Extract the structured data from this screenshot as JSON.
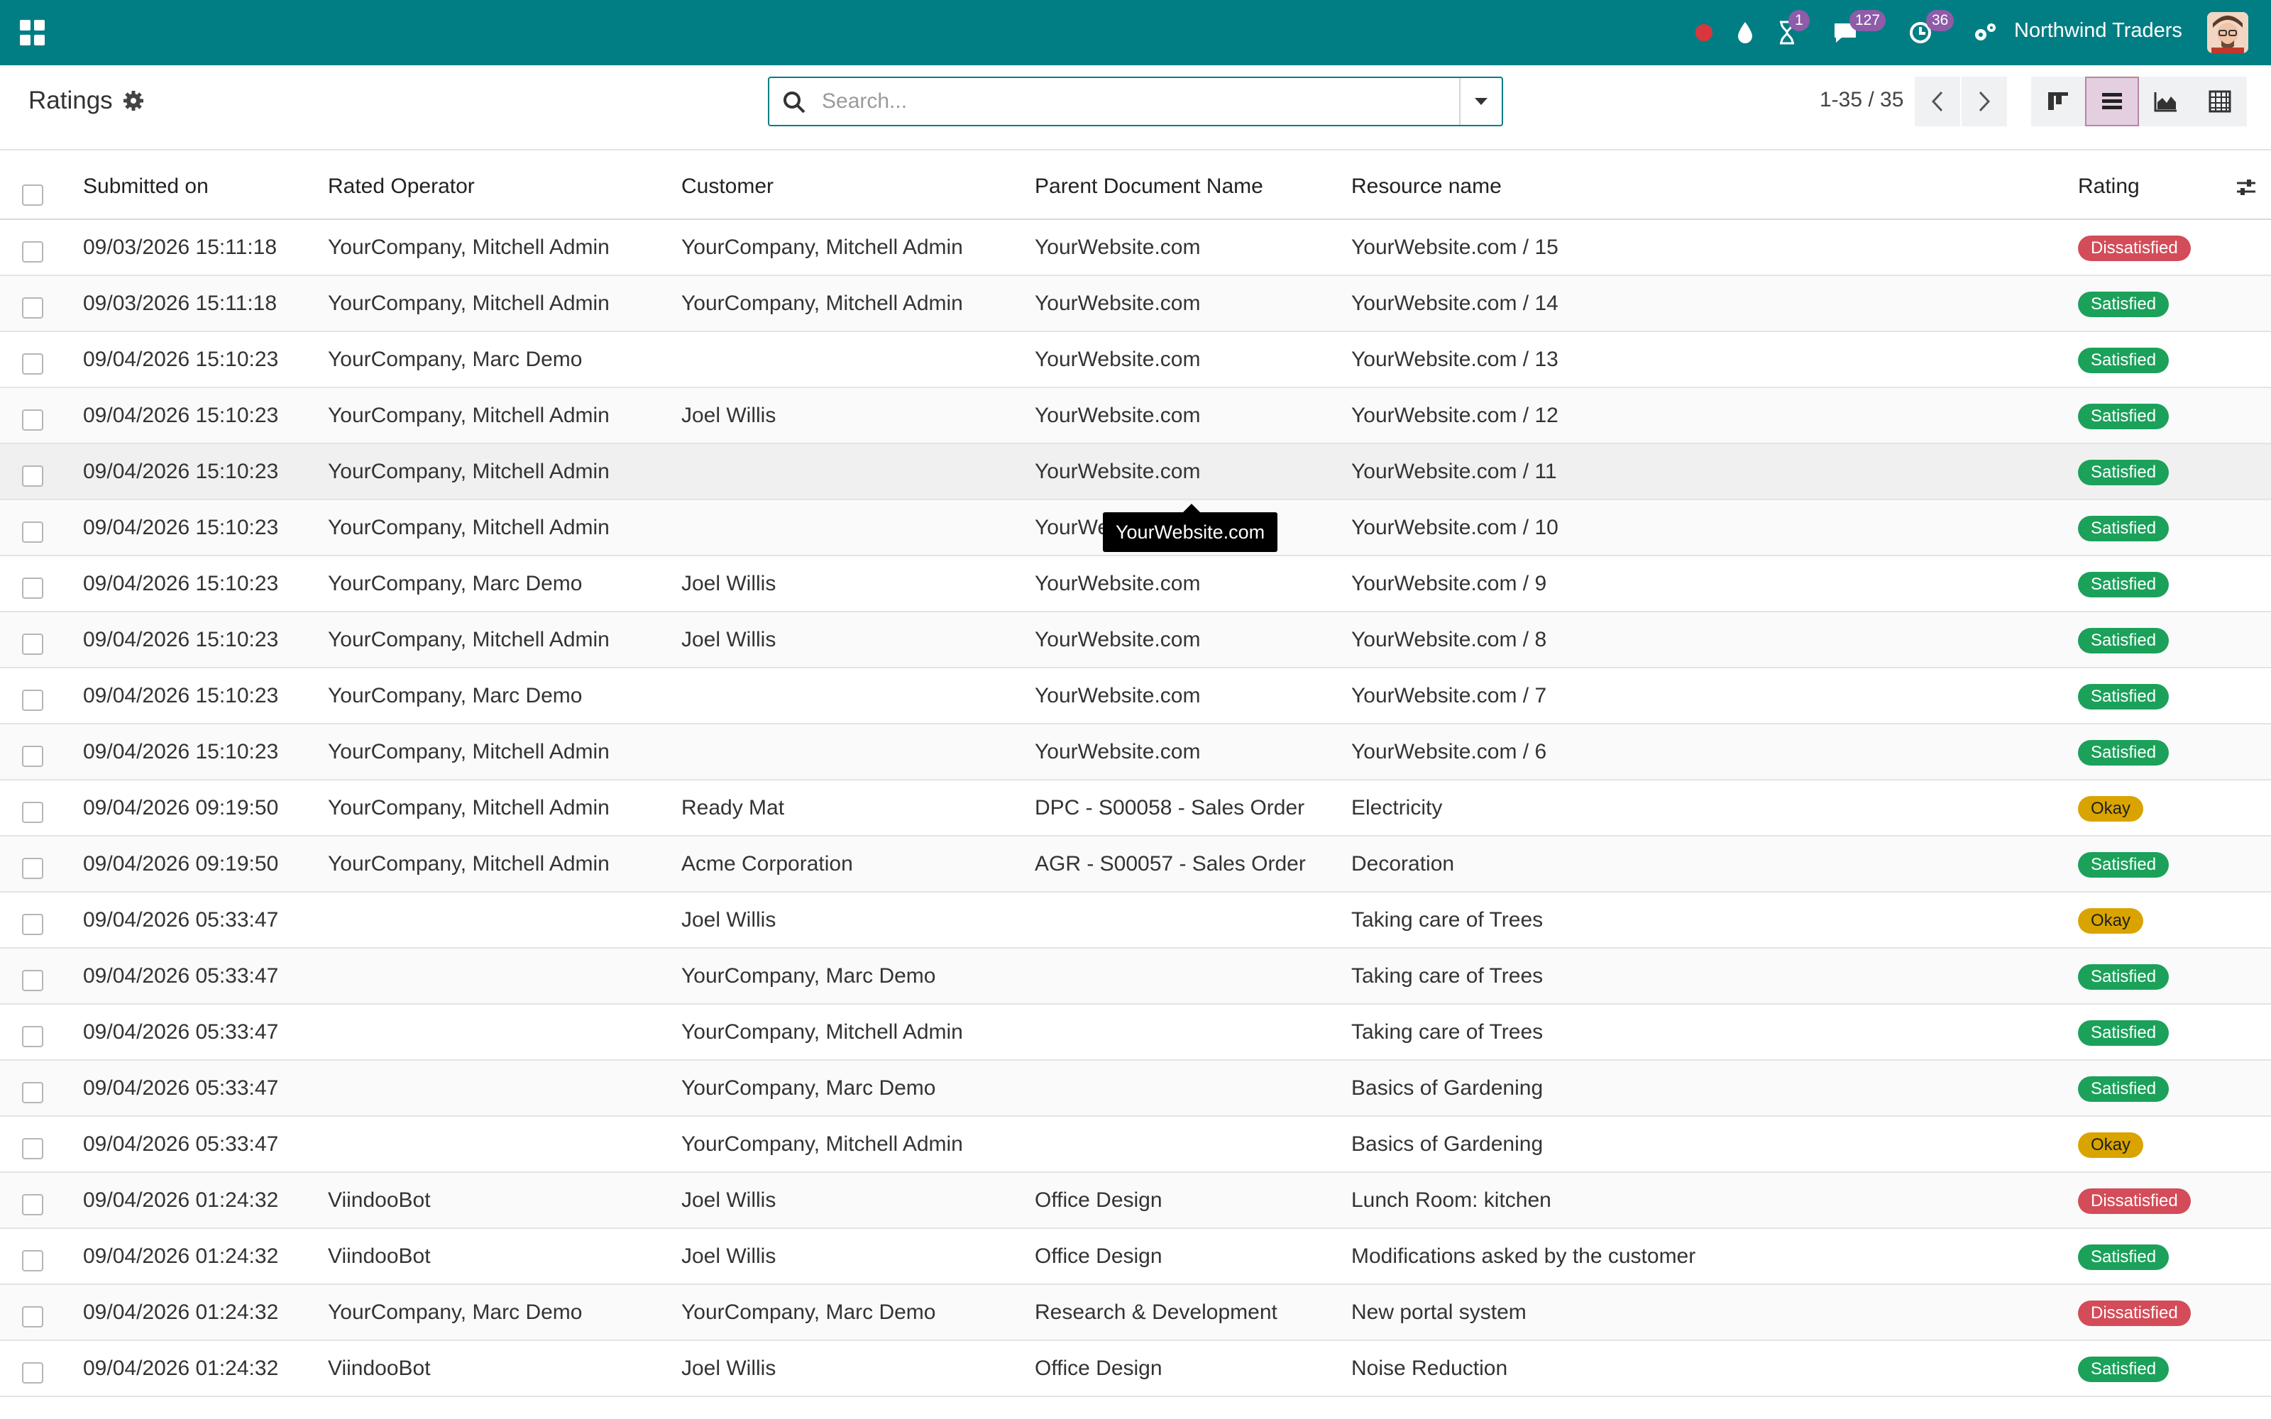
{
  "topbar": {
    "company": "Northwind Traders",
    "badges": {
      "activity": "1",
      "messages": "127",
      "timer": "36"
    },
    "colors": {
      "bar": "#017e84",
      "badge": "#8e5ca8",
      "record": "#d9363e"
    }
  },
  "control_panel": {
    "title": "Ratings",
    "search_placeholder": "Search...",
    "pager": "1-35 / 35"
  },
  "columns": [
    "Submitted on",
    "Rated Operator",
    "Customer",
    "Parent Document Name",
    "Resource name",
    "Rating"
  ],
  "rows": [
    {
      "submitted": "09/03/2026 15:11:18",
      "operator": "YourCompany, Mitchell Admin",
      "customer": "YourCompany, Mitchell Admin",
      "parent": "YourWebsite.com",
      "resource": "YourWebsite.com / 15",
      "rating": "Dissatisfied",
      "kind": "dis"
    },
    {
      "submitted": "09/03/2026 15:11:18",
      "operator": "YourCompany, Mitchell Admin",
      "customer": "YourCompany, Mitchell Admin",
      "parent": "YourWebsite.com",
      "resource": "YourWebsite.com / 14",
      "rating": "Satisfied",
      "kind": "sat"
    },
    {
      "submitted": "09/04/2026 15:10:23",
      "operator": "YourCompany, Marc Demo",
      "customer": "",
      "parent": "YourWebsite.com",
      "resource": "YourWebsite.com / 13",
      "rating": "Satisfied",
      "kind": "sat"
    },
    {
      "submitted": "09/04/2026 15:10:23",
      "operator": "YourCompany, Mitchell Admin",
      "customer": "Joel Willis",
      "parent": "YourWebsite.com",
      "resource": "YourWebsite.com / 12",
      "rating": "Satisfied",
      "kind": "sat"
    },
    {
      "submitted": "09/04/2026 15:10:23",
      "operator": "YourCompany, Mitchell Admin",
      "customer": "",
      "parent": "YourWebsite.com",
      "resource": "YourWebsite.com / 11",
      "rating": "Satisfied",
      "kind": "sat"
    },
    {
      "submitted": "09/04/2026 15:10:23",
      "operator": "YourCompany, Mitchell Admin",
      "customer": "",
      "parent": "YourWebsite.com",
      "resource": "YourWebsite.com / 10",
      "rating": "Satisfied",
      "kind": "sat"
    },
    {
      "submitted": "09/04/2026 15:10:23",
      "operator": "YourCompany, Marc Demo",
      "customer": "Joel Willis",
      "parent": "YourWebsite.com",
      "resource": "YourWebsite.com / 9",
      "rating": "Satisfied",
      "kind": "sat"
    },
    {
      "submitted": "09/04/2026 15:10:23",
      "operator": "YourCompany, Mitchell Admin",
      "customer": "Joel Willis",
      "parent": "YourWebsite.com",
      "resource": "YourWebsite.com / 8",
      "rating": "Satisfied",
      "kind": "sat"
    },
    {
      "submitted": "09/04/2026 15:10:23",
      "operator": "YourCompany, Marc Demo",
      "customer": "",
      "parent": "YourWebsite.com",
      "resource": "YourWebsite.com / 7",
      "rating": "Satisfied",
      "kind": "sat"
    },
    {
      "submitted": "09/04/2026 15:10:23",
      "operator": "YourCompany, Mitchell Admin",
      "customer": "",
      "parent": "YourWebsite.com",
      "resource": "YourWebsite.com / 6",
      "rating": "Satisfied",
      "kind": "sat"
    },
    {
      "submitted": "09/04/2026 09:19:50",
      "operator": "YourCompany, Mitchell Admin",
      "customer": "Ready Mat",
      "parent": "DPC - S00058 - Sales Order",
      "resource": "Electricity",
      "rating": "Okay",
      "kind": "ok"
    },
    {
      "submitted": "09/04/2026 09:19:50",
      "operator": "YourCompany, Mitchell Admin",
      "customer": "Acme Corporation",
      "parent": "AGR - S00057 - Sales Order",
      "resource": "Decoration",
      "rating": "Satisfied",
      "kind": "sat"
    },
    {
      "submitted": "09/04/2026 05:33:47",
      "operator": "",
      "customer": "Joel Willis",
      "parent": "",
      "resource": "Taking care of Trees",
      "rating": "Okay",
      "kind": "ok"
    },
    {
      "submitted": "09/04/2026 05:33:47",
      "operator": "",
      "customer": "YourCompany, Marc Demo",
      "parent": "",
      "resource": "Taking care of Trees",
      "rating": "Satisfied",
      "kind": "sat"
    },
    {
      "submitted": "09/04/2026 05:33:47",
      "operator": "",
      "customer": "YourCompany, Mitchell Admin",
      "parent": "",
      "resource": "Taking care of Trees",
      "rating": "Satisfied",
      "kind": "sat"
    },
    {
      "submitted": "09/04/2026 05:33:47",
      "operator": "",
      "customer": "YourCompany, Marc Demo",
      "parent": "",
      "resource": "Basics of Gardening",
      "rating": "Satisfied",
      "kind": "sat"
    },
    {
      "submitted": "09/04/2026 05:33:47",
      "operator": "",
      "customer": "YourCompany, Mitchell Admin",
      "parent": "",
      "resource": "Basics of Gardening",
      "rating": "Okay",
      "kind": "ok"
    },
    {
      "submitted": "09/04/2026 01:24:32",
      "operator": "ViindooBot",
      "customer": "Joel Willis",
      "parent": "Office Design",
      "resource": "Lunch Room: kitchen",
      "rating": "Dissatisfied",
      "kind": "dis"
    },
    {
      "submitted": "09/04/2026 01:24:32",
      "operator": "ViindooBot",
      "customer": "Joel Willis",
      "parent": "Office Design",
      "resource": "Modifications asked by the customer",
      "rating": "Satisfied",
      "kind": "sat"
    },
    {
      "submitted": "09/04/2026 01:24:32",
      "operator": "YourCompany, Marc Demo",
      "customer": "YourCompany, Marc Demo",
      "parent": "Research & Development",
      "resource": "New portal system",
      "rating": "Dissatisfied",
      "kind": "dis"
    },
    {
      "submitted": "09/04/2026 01:24:32",
      "operator": "ViindooBot",
      "customer": "Joel Willis",
      "parent": "Office Design",
      "resource": "Noise Reduction",
      "rating": "Satisfied",
      "kind": "sat"
    }
  ],
  "tooltip": "YourWebsite.com"
}
